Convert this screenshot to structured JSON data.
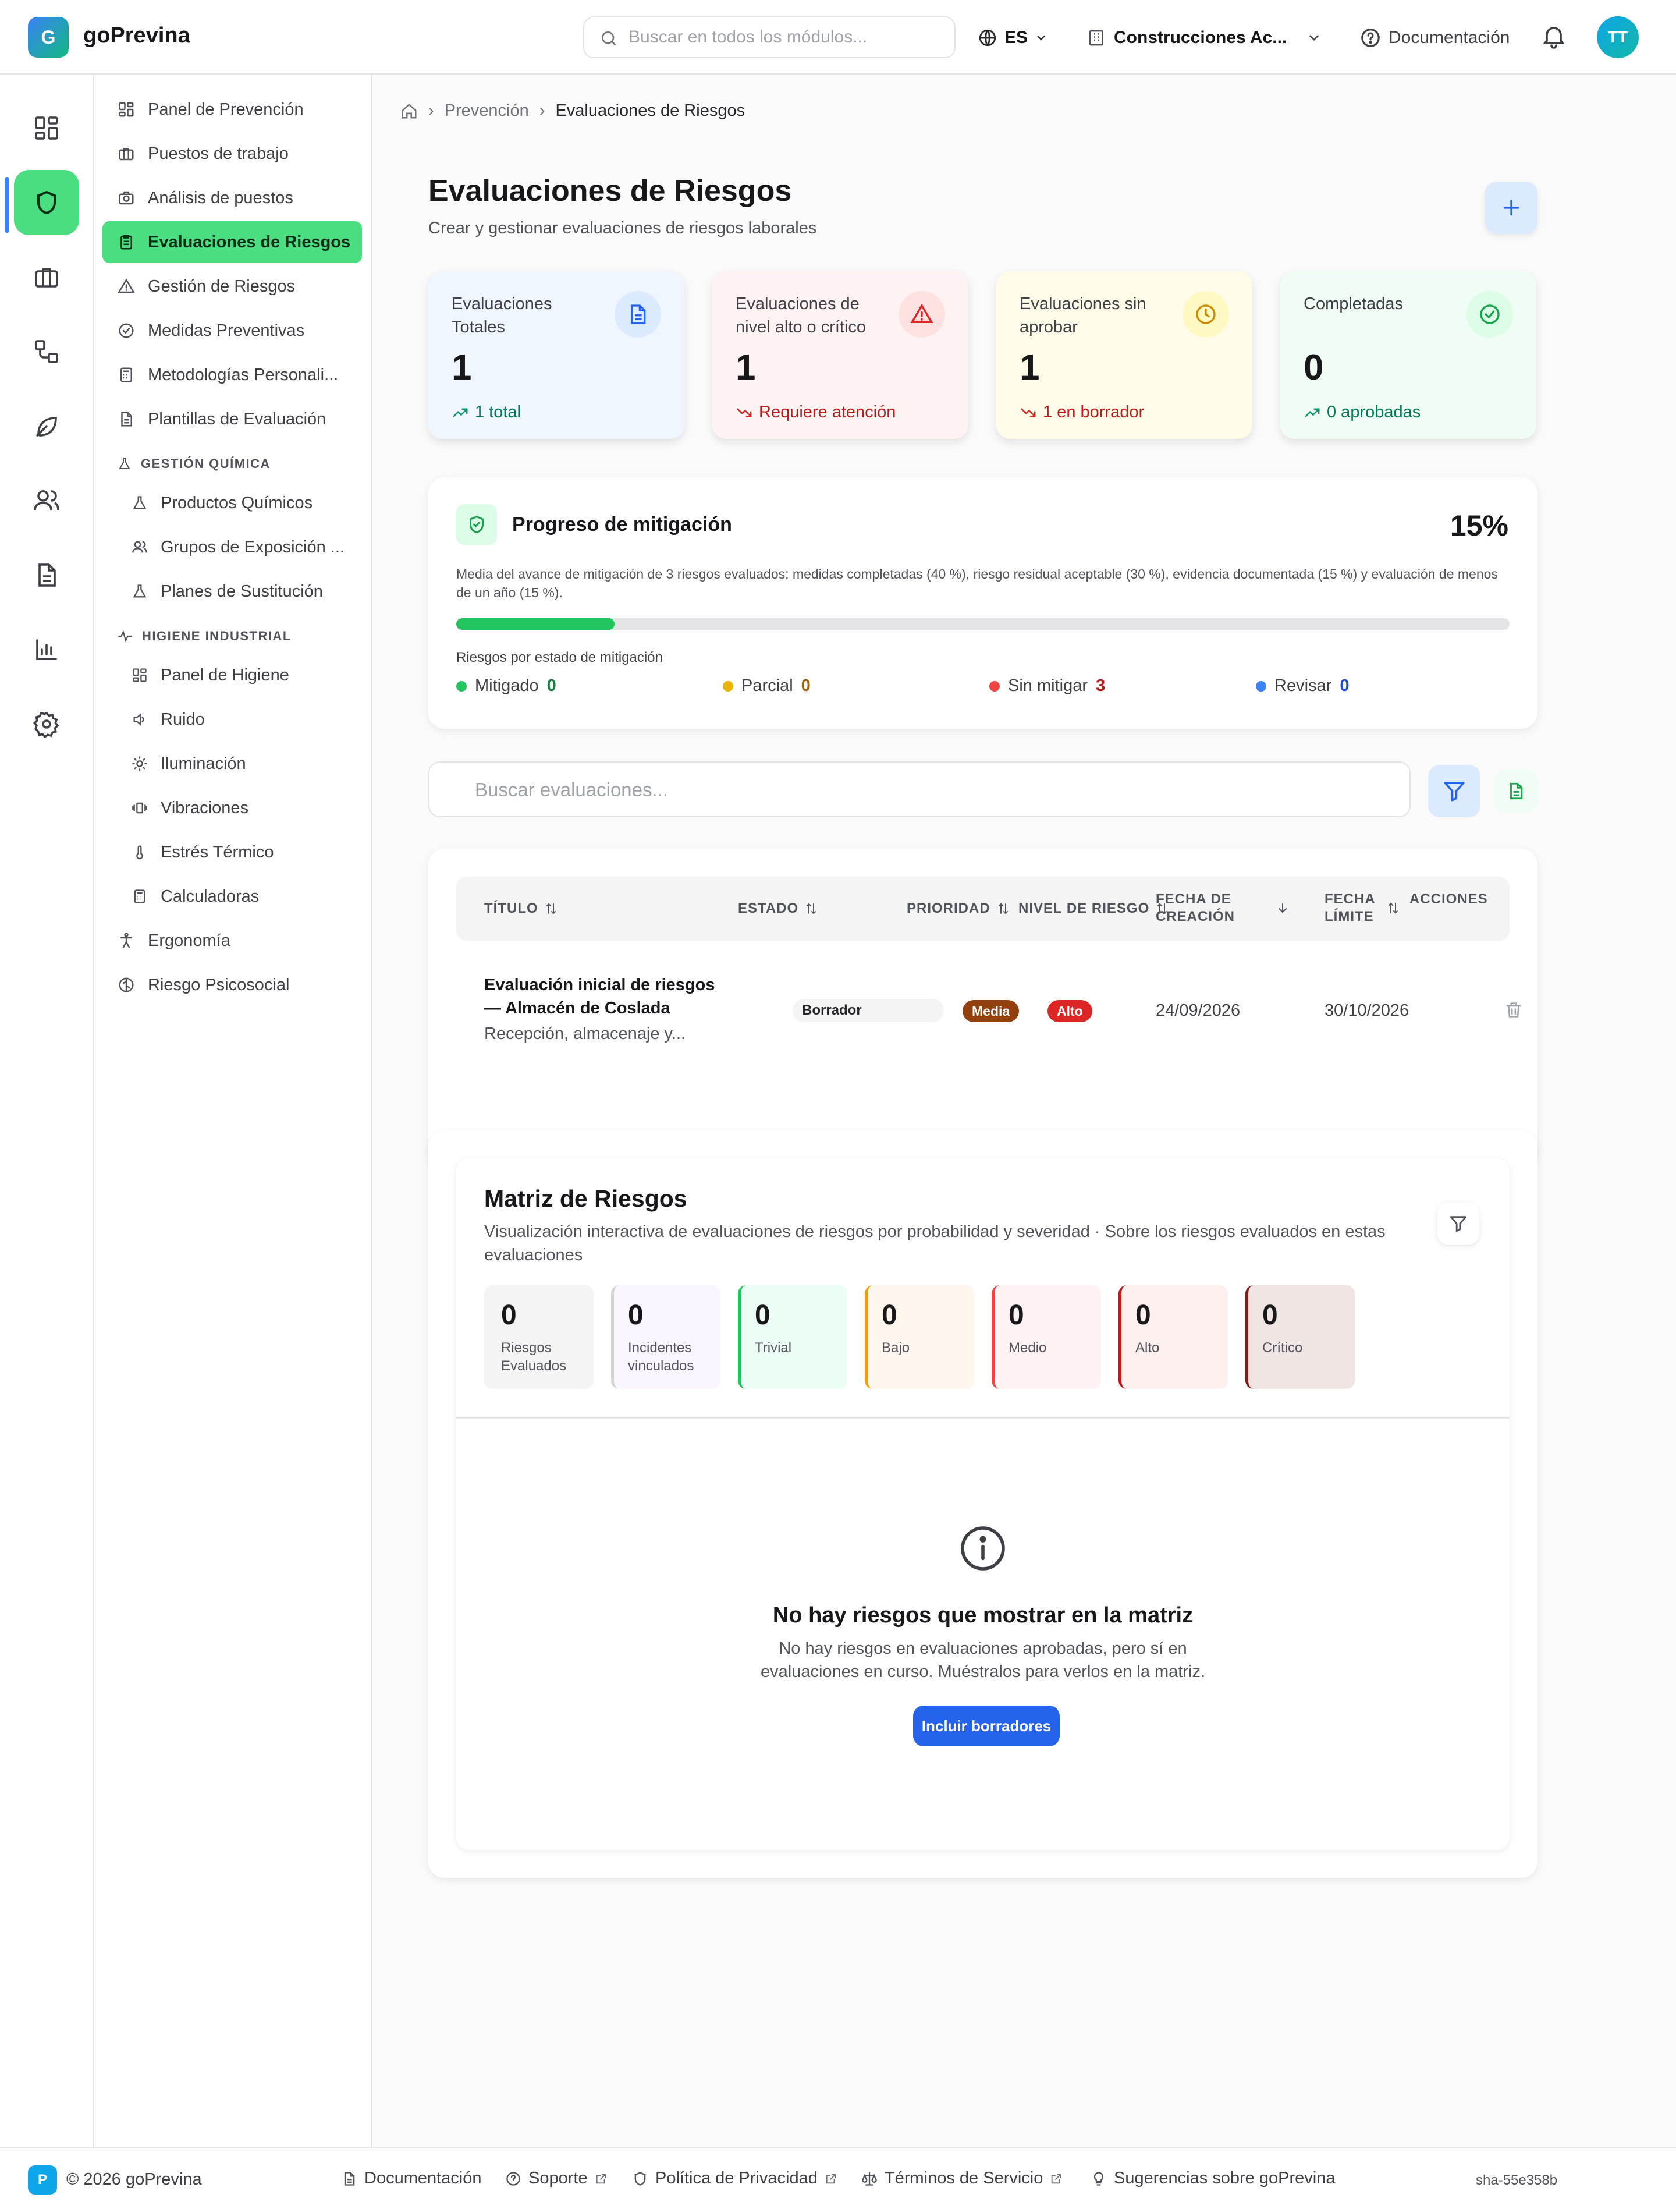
{
  "app": {
    "logo_letter": "G",
    "name": "goPrevina"
  },
  "topbar": {
    "search_placeholder": "Buscar en todos los módulos...",
    "language": "ES",
    "company": "Construcciones Ac...",
    "docs": "Documentación",
    "user_initials": "TT"
  },
  "rail": {
    "icons": [
      "dashboard-icon",
      "shield-icon",
      "briefcase-icon",
      "workflow-icon",
      "leaf-icon",
      "users-icon",
      "document-icon",
      "bar-chart-icon",
      "settings-icon"
    ],
    "active": "shield-icon"
  },
  "sidebar": {
    "items": [
      {
        "label": "Panel de Prevención",
        "icon": "dashboard-icon"
      },
      {
        "label": "Puestos de trabajo",
        "icon": "briefcase-icon"
      },
      {
        "label": "Análisis de puestos",
        "icon": "camera-icon"
      },
      {
        "label": "Evaluaciones de Riesgos",
        "icon": "clipboard-icon",
        "active": true
      },
      {
        "label": "Gestión de Riesgos",
        "icon": "warning-icon"
      },
      {
        "label": "Medidas Preventivas",
        "icon": "check-circle-icon"
      },
      {
        "label": "Metodologías Personali...",
        "icon": "calculator-icon"
      },
      {
        "label": "Plantillas de Evaluación",
        "icon": "file-icon"
      }
    ],
    "section_chem": "GESTIÓN QUÍMICA",
    "chem_items": [
      {
        "label": "Productos Químicos",
        "icon": "flask-icon"
      },
      {
        "label": "Grupos de Exposición ...",
        "icon": "users-icon"
      },
      {
        "label": "Planes de Sustitución",
        "icon": "flask-icon"
      }
    ],
    "section_hyg": "HIGIENE INDUSTRIAL",
    "hyg_items": [
      {
        "label": "Panel de Higiene",
        "icon": "dashboard-icon"
      },
      {
        "label": "Ruido",
        "icon": "volume-icon"
      },
      {
        "label": "Iluminación",
        "icon": "sun-icon"
      },
      {
        "label": "Vibraciones",
        "icon": "vibration-icon"
      },
      {
        "label": "Estrés Térmico",
        "icon": "thermometer-icon"
      },
      {
        "label": "Calculadoras",
        "icon": "calculator-icon"
      }
    ],
    "bottom_items": [
      {
        "label": "Ergonomía",
        "icon": "accessibility-icon"
      },
      {
        "label": "Riesgo Psicosocial",
        "icon": "brain-icon"
      }
    ]
  },
  "breadcrumb": {
    "items": [
      "Prevención",
      "Evaluaciones de Riesgos"
    ]
  },
  "page": {
    "title": "Evaluaciones de Riesgos",
    "subtitle": "Crear y gestionar evaluaciones de riesgos laborales"
  },
  "stats": [
    {
      "label": "Evaluaciones Totales",
      "value": "1",
      "trend": "1 total",
      "trend_dir": "up",
      "icon": "document-icon",
      "bg": "#eff6ff",
      "icon_bg": "#dbeafe",
      "icon_color": "#2563eb",
      "trend_color": "#047857"
    },
    {
      "label": "Evaluaciones de nivel alto o crítico",
      "value": "1",
      "trend": "Requiere atención",
      "trend_dir": "down",
      "icon": "warning-icon",
      "bg": "#fef2f2",
      "icon_bg": "#fee2e2",
      "icon_color": "#dc2626",
      "trend_color": "#b91c1c"
    },
    {
      "label": "Evaluaciones sin aprobar",
      "value": "1",
      "trend": "1 en borrador",
      "trend_dir": "down",
      "icon": "clock-icon",
      "bg": "#fefce8",
      "icon_bg": "#fef9c3",
      "icon_color": "#ca8a04",
      "trend_color": "#b91c1c"
    },
    {
      "label": "Completadas",
      "value": "0",
      "trend": "0 aprobadas",
      "trend_dir": "up",
      "icon": "check-circle-icon",
      "bg": "#f0fdf4",
      "icon_bg": "#dcfce7",
      "icon_color": "#16a34a",
      "trend_color": "#047857"
    }
  ],
  "mitigation": {
    "title": "Progreso de mitigación",
    "percent_label": "15%",
    "progress": 15,
    "description": "Media del avance de mitigación de 3 riesgos evaluados: medidas completadas (40 %), riesgo residual aceptable (30 %), evidencia documentada (15 %) y evaluación de menos de un año (15 %).",
    "status_label": "Riesgos por estado de mitigación",
    "legend": [
      {
        "label": "Mitigado",
        "count": "0",
        "color": "#22c55e",
        "count_color": "#15803d"
      },
      {
        "label": "Parcial",
        "count": "0",
        "color": "#eab308",
        "count_color": "#a16207"
      },
      {
        "label": "Sin mitigar",
        "count": "3",
        "color": "#ef4444",
        "count_color": "#b91c1c"
      },
      {
        "label": "Revisar",
        "count": "0",
        "color": "#3b82f6",
        "count_color": "#1d4ed8"
      }
    ]
  },
  "search": {
    "placeholder": "Buscar evaluaciones..."
  },
  "table": {
    "columns": [
      "TÍTULO",
      "ESTADO",
      "PRIORIDAD",
      "NIVEL DE RIESGO",
      "FECHA DE CREACIÓN",
      "FECHA LÍMITE",
      "ACCIONES"
    ],
    "rows": [
      {
        "title": "Evaluación inicial de riesgos — Almacén de Coslada",
        "subtitle": "Recepción, almacenaje y...",
        "status": "Borrador",
        "priority": "Media",
        "risk": "Alto",
        "created": "24/09/2026",
        "due": "30/10/2026"
      }
    ]
  },
  "matrix": {
    "title": "Matriz de Riesgos",
    "description": "Visualización interactiva de evaluaciones de riesgos por probabilidad y severidad · Sobre los riesgos evaluados en estas evaluaciones",
    "stats": [
      {
        "value": "0",
        "label": "Riesgos Evaluados",
        "bg": "#f4f4f5",
        "border": "#f4f4f5"
      },
      {
        "value": "0",
        "label": "Incidentes vinculados",
        "bg": "#faf5ff",
        "border": "#d4d4d8"
      },
      {
        "value": "0",
        "label": "Trivial",
        "bg": "#ecfdf5",
        "border": "#22c55e"
      },
      {
        "value": "0",
        "label": "Bajo",
        "bg": "#fff7ed",
        "border": "#f59e0b"
      },
      {
        "value": "0",
        "label": "Medio",
        "bg": "#fef2f2",
        "border": "#ef4444"
      },
      {
        "value": "0",
        "label": "Alto",
        "bg": "#fdf0ee",
        "border": "#b91c1c"
      },
      {
        "value": "0",
        "label": "Crítico",
        "bg": "#efe5e3",
        "border": "#7f1d1d"
      }
    ],
    "empty_title": "No hay riesgos que mostrar en la matriz",
    "empty_text": "No hay riesgos en evaluaciones aprobadas, pero sí en evaluaciones en curso. Muéstralos para verlos en la matriz.",
    "button": "Incluir borradores"
  },
  "footer": {
    "logo_letter": "P",
    "copyright": "© 2026 goPrevina",
    "links": [
      {
        "label": "Documentación",
        "icon": "document-icon",
        "external": false
      },
      {
        "label": "Soporte",
        "icon": "help-icon",
        "external": true
      },
      {
        "label": "Política de Privacidad",
        "icon": "shield-icon",
        "external": true
      },
      {
        "label": "Términos de Servicio",
        "icon": "scale-icon",
        "external": true
      },
      {
        "label": "Sugerencias sobre goPrevina",
        "icon": "lightbulb-icon",
        "external": false
      }
    ],
    "version": "sha-55e358b"
  }
}
